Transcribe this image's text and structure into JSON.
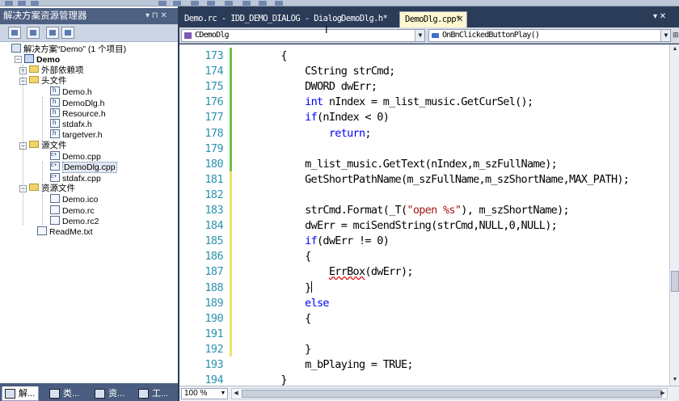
{
  "solution_explorer": {
    "title": "解决方案资源管理器",
    "pin_label": "▾ ⊓ ✕",
    "tree": [
      {
        "label": "解决方案“Demo” (1 个项目)",
        "icon": "solution-icon",
        "level": 0
      },
      {
        "label": "Demo",
        "icon": "project-icon",
        "level": 0,
        "bold": true
      },
      {
        "label": "外部依赖项",
        "icon": "folder-icon",
        "level": 1
      },
      {
        "label": "头文件",
        "icon": "folder-icon",
        "level": 1
      },
      {
        "label": "Demo.h",
        "icon": "header-file-icon",
        "level": 2
      },
      {
        "label": "DemoDlg.h",
        "icon": "header-file-icon",
        "level": 2
      },
      {
        "label": "Resource.h",
        "icon": "header-file-icon",
        "level": 2
      },
      {
        "label": "stdafx.h",
        "icon": "header-file-icon",
        "level": 2
      },
      {
        "label": "targetver.h",
        "icon": "header-file-icon",
        "level": 2
      },
      {
        "label": "源文件",
        "icon": "folder-icon",
        "level": 1
      },
      {
        "label": "Demo.cpp",
        "icon": "cpp-file-icon",
        "level": 2
      },
      {
        "label": "DemoDlg.cpp",
        "icon": "cpp-file-icon",
        "level": 2,
        "selected": true
      },
      {
        "label": "stdafx.cpp",
        "icon": "cpp-file-icon",
        "level": 2
      },
      {
        "label": "资源文件",
        "icon": "folder-icon",
        "level": 1
      },
      {
        "label": "Demo.ico",
        "icon": "resource-file-icon",
        "level": 2
      },
      {
        "label": "Demo.rc",
        "icon": "resource-file-icon",
        "level": 2
      },
      {
        "label": "Demo.rc2",
        "icon": "resource-file-icon",
        "level": 2
      },
      {
        "label": "ReadMe.txt",
        "icon": "text-file-icon",
        "level": 1
      }
    ],
    "bottom_tabs": [
      "解...",
      "类...",
      "资...",
      "工..."
    ]
  },
  "editor": {
    "tabs": [
      {
        "label": "Demo.rc - IDD_DEMO_DIALOG - Dialog",
        "active": false
      },
      {
        "label": "DemoDlg.h*",
        "active": false
      },
      {
        "label": "DemoDlg.cpp*",
        "active": true
      }
    ],
    "tab_controls": "▾ ✕",
    "class_combo": "CDemoDlg",
    "member_combo": "OnBnClickedButtonPlay()",
    "zoom": "100 %",
    "lines": [
      {
        "n": "173",
        "tokens": [
          [
            "t",
            "        {"
          ]
        ]
      },
      {
        "n": "174",
        "tokens": [
          [
            "t",
            "            CString strCmd;"
          ]
        ]
      },
      {
        "n": "175",
        "tokens": [
          [
            "t",
            "            DWORD dwErr;"
          ]
        ]
      },
      {
        "n": "176",
        "tokens": [
          [
            "t",
            "            "
          ],
          [
            "kw",
            "int"
          ],
          [
            "t",
            " nIndex = m_list_music.GetCurSel();"
          ]
        ]
      },
      {
        "n": "177",
        "tokens": [
          [
            "t",
            "            "
          ],
          [
            "kw",
            "if"
          ],
          [
            "t",
            "(nIndex < 0)"
          ]
        ]
      },
      {
        "n": "178",
        "tokens": [
          [
            "t",
            "                "
          ],
          [
            "kw",
            "return"
          ],
          [
            "t",
            ";"
          ]
        ]
      },
      {
        "n": "179",
        "tokens": [
          [
            "t",
            ""
          ]
        ]
      },
      {
        "n": "180",
        "tokens": [
          [
            "t",
            "            m_list_music.GetText(nIndex,m_szFullName);"
          ]
        ]
      },
      {
        "n": "181",
        "tokens": [
          [
            "t",
            "            GetShortPathName(m_szFullName,m_szShortName,MAX_PATH);"
          ]
        ]
      },
      {
        "n": "182",
        "tokens": [
          [
            "t",
            ""
          ]
        ]
      },
      {
        "n": "183",
        "tokens": [
          [
            "t",
            "            strCmd.Format(_T("
          ],
          [
            "str",
            "\"open %s\""
          ],
          [
            "t",
            "), m_szShortName);"
          ]
        ]
      },
      {
        "n": "184",
        "tokens": [
          [
            "t",
            "            dwErr = mciSendString(strCmd,NULL,0,NULL);"
          ]
        ]
      },
      {
        "n": "185",
        "tokens": [
          [
            "t",
            "            "
          ],
          [
            "kw",
            "if"
          ],
          [
            "t",
            "(dwErr != 0)"
          ]
        ]
      },
      {
        "n": "186",
        "tokens": [
          [
            "t",
            "            {"
          ]
        ]
      },
      {
        "n": "187",
        "tokens": [
          [
            "t",
            "                "
          ],
          [
            "err",
            "ErrBox"
          ],
          [
            "t",
            "(dwErr);"
          ]
        ]
      },
      {
        "n": "188",
        "tokens": [
          [
            "t",
            "            }"
          ],
          [
            "caret",
            ""
          ]
        ]
      },
      {
        "n": "189",
        "tokens": [
          [
            "t",
            "            "
          ],
          [
            "kw",
            "else"
          ]
        ]
      },
      {
        "n": "190",
        "tokens": [
          [
            "t",
            "            {"
          ]
        ]
      },
      {
        "n": "191",
        "tokens": [
          [
            "t",
            ""
          ]
        ]
      },
      {
        "n": "192",
        "tokens": [
          [
            "t",
            "            }"
          ]
        ]
      },
      {
        "n": "193",
        "tokens": [
          [
            "t",
            "            m_bPlaying = TRUE;"
          ]
        ]
      },
      {
        "n": "194",
        "tokens": [
          [
            "t",
            "        }"
          ]
        ]
      }
    ],
    "change_marks": [
      {
        "from": 0,
        "to": 7,
        "color": "green"
      },
      {
        "from": 8,
        "to": 19,
        "color": "yellow"
      }
    ]
  },
  "colors": {
    "keyword": "#0000ff",
    "string": "#a31515",
    "line_number": "#2b91af",
    "changed_saved": "#6cbf4a",
    "changed_unsaved": "#f1e26b",
    "chrome": "#2b3c59"
  }
}
